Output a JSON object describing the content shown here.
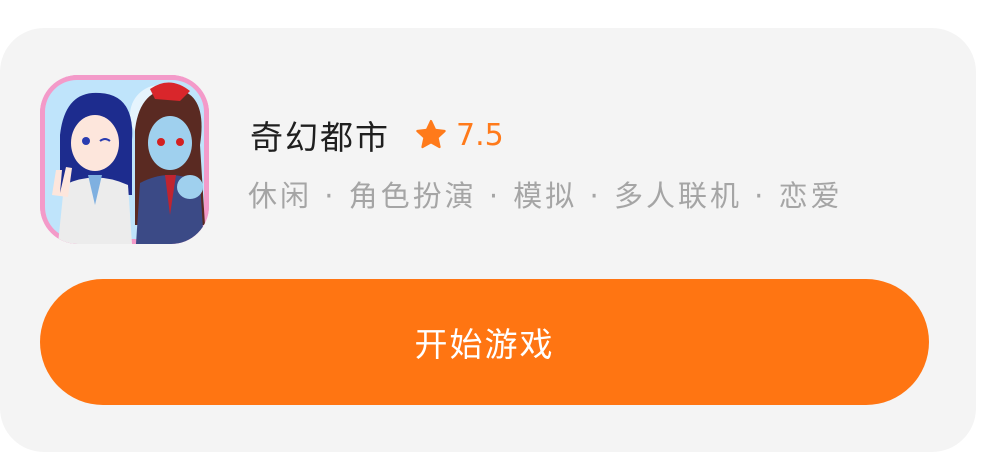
{
  "game": {
    "title": "奇幻都市",
    "rating": "7.5",
    "tags": "休闲 · 角色扮演 · 模拟 · 多人联机 · 恋爱",
    "icon": "anime-characters-app-icon"
  },
  "actions": {
    "play_label": "开始游戏"
  },
  "colors": {
    "accent": "#ff7512",
    "rating": "#ff7a1a",
    "card_bg": "#f4f4f4",
    "tag_text": "#a5a5a5"
  }
}
